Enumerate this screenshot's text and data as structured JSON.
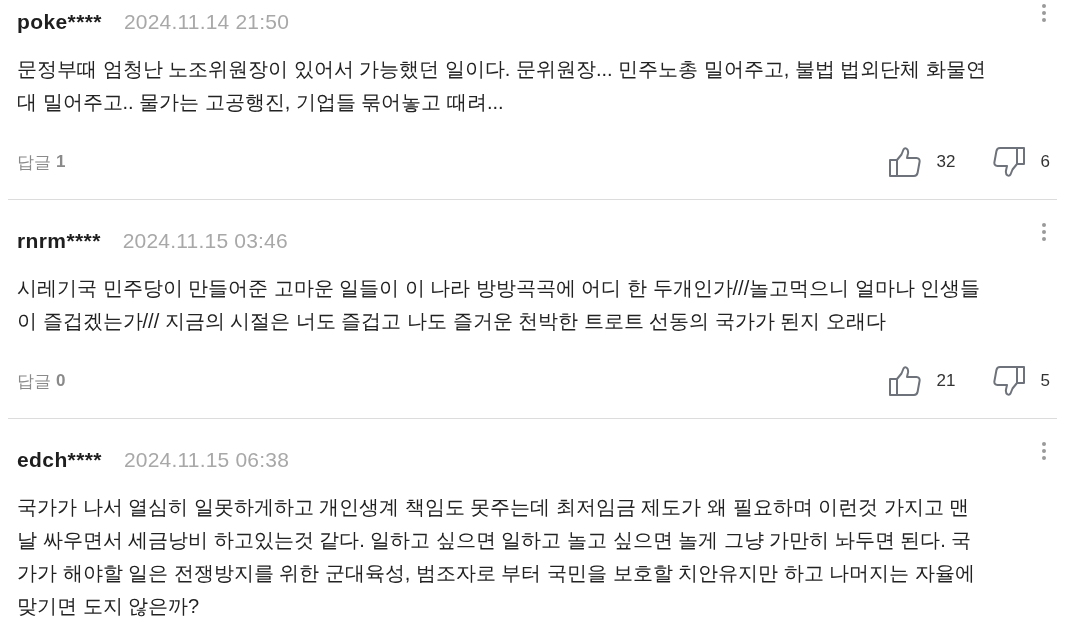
{
  "comments": [
    {
      "username": "poke****",
      "date": "2024.11.14 21:50",
      "body": "문정부때 엄청난 노조위원장이 있어서 가능했던 일이다. 문위원장... 민주노총 밀어주고, 불법 법외단체 화물연대 밀어주고.. 물가는 고공행진, 기업들 묶어놓고 때려...",
      "replies_label": "답글",
      "replies_count": "1",
      "likes": "32",
      "dislikes": "6"
    },
    {
      "username": "rnrm****",
      "date": "2024.11.15 03:46",
      "body": "시레기국 민주당이 만들어준 고마운 일들이 이 나라 방방곡곡에 어디 한 두개인가///놀고먹으니 얼마나 인생들이 즐겁겠는가/// 지금의 시절은 너도 즐겁고 나도 즐거운 천박한 트로트 선동의 국가가 된지 오래다",
      "replies_label": "답글",
      "replies_count": "0",
      "likes": "21",
      "dislikes": "5"
    },
    {
      "username": "edch****",
      "date": "2024.11.15 06:38",
      "body": "국가가 나서 열심히 일못하게하고 개인생계 책임도 못주는데 최저임금 제도가 왜 필요하며 이런것 가지고 맨날 싸우면서 세금낭비 하고있는것 같다. 일하고 싶으면 일하고 놀고 싶으면 놀게 그냥 가만히 놔두면 된다. 국가가 해야할 일은 전쟁방지를 위한 군대육성, 범조자로 부터 국민을 보호할 치안유지만 하고 나머지는 자율에 맞기면 도지 않은까?"
    }
  ]
}
